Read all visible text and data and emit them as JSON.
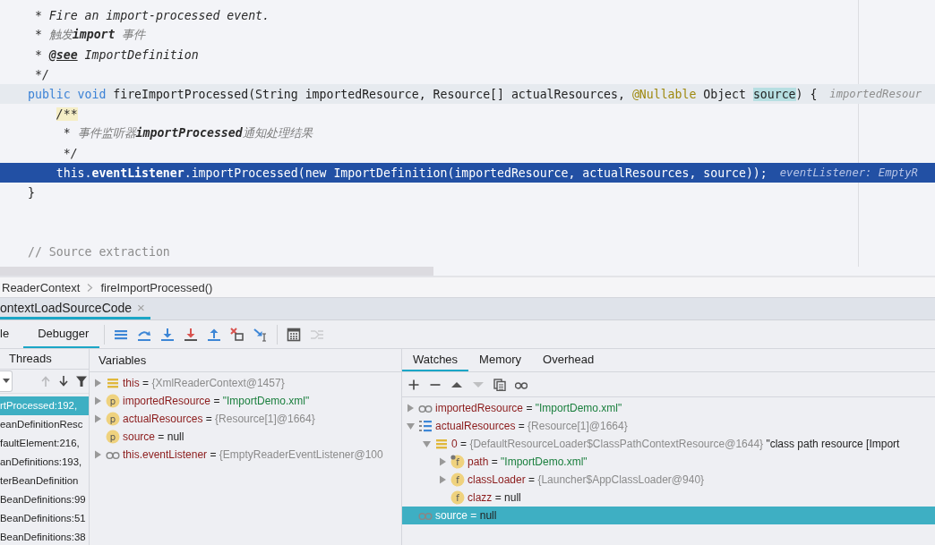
{
  "editor": {
    "lines": [
      {
        "current": false,
        "execution_point": false,
        "tokens": [
          {
            "kind": "doc",
            "text": " * Fire an import-processed event."
          }
        ]
      },
      {
        "current": false,
        "execution_point": false,
        "tokens": [
          {
            "kind": "doc",
            "text": " * "
          },
          {
            "kind": "doc-cjk",
            "text": "触发"
          },
          {
            "kind": "doc-bold",
            "text": "import"
          },
          {
            "kind": "doc-cjk",
            "text": " 事件"
          }
        ]
      },
      {
        "current": false,
        "execution_point": false,
        "tokens": [
          {
            "kind": "doc",
            "text": " * "
          },
          {
            "kind": "doc-tag",
            "text": "@see"
          },
          {
            "kind": "doc",
            "text": " ImportDefinition"
          }
        ]
      },
      {
        "current": false,
        "execution_point": false,
        "tokens": [
          {
            "kind": "doc",
            "text": " */"
          }
        ]
      },
      {
        "current": true,
        "execution_point": false,
        "hint": "importedResour",
        "tokens": [
          {
            "kind": "keyword",
            "text": "public void "
          },
          {
            "kind": "plain",
            "text": "fireImportProcessed(String importedResource, Resource[] actualResources, "
          },
          {
            "kind": "annotation",
            "text": "@Nullable"
          },
          {
            "kind": "plain",
            "text": " Object "
          },
          {
            "kind": "usage",
            "text": "source"
          },
          {
            "kind": "plain",
            "text": ") {"
          }
        ]
      },
      {
        "current": false,
        "execution_point": false,
        "tokens": [
          {
            "kind": "doc-start",
            "text": "    /**"
          }
        ]
      },
      {
        "current": false,
        "execution_point": false,
        "tokens": [
          {
            "kind": "doc",
            "text": "     * "
          },
          {
            "kind": "doc-cjk",
            "text": "事件监听器"
          },
          {
            "kind": "doc-bold",
            "text": "importProcessed"
          },
          {
            "kind": "doc-cjk",
            "text": "通知处理结果"
          }
        ]
      },
      {
        "current": false,
        "execution_point": false,
        "tokens": [
          {
            "kind": "doc",
            "text": "     */"
          }
        ]
      },
      {
        "current": false,
        "execution_point": true,
        "hint": "eventListener: EmptyR",
        "tokens": [
          {
            "kind": "plain",
            "text": "    this."
          },
          {
            "kind": "field",
            "text": "eventListener"
          },
          {
            "kind": "plain",
            "text": ".importProcessed(new ImportDefinition(importedResource, actualResources, source));"
          }
        ]
      },
      {
        "current": false,
        "execution_point": false,
        "tokens": [
          {
            "kind": "plain",
            "text": "}"
          }
        ]
      },
      {
        "current": false,
        "execution_point": false
      },
      {
        "current": false,
        "execution_point": false
      },
      {
        "current": false,
        "execution_point": false,
        "tokens": [
          {
            "kind": "comment",
            "text": "// Source extraction"
          }
        ]
      }
    ]
  },
  "breadcrumbs": [
    "ReaderContext",
    "fireImportProcessed()"
  ],
  "run_tabs": [
    {
      "label": "ontextLoadSourceCode",
      "close": "×",
      "selected": true
    }
  ],
  "debug_tabs": [
    {
      "label": "le",
      "selected": false
    },
    {
      "label": "Debugger",
      "selected": true
    }
  ],
  "debug_toolbar": [
    {
      "disabled": false
    },
    {
      "disabled": false
    },
    {
      "disabled": false
    },
    {
      "disabled": false
    },
    {
      "disabled": false
    },
    {
      "disabled": false
    },
    {
      "disabled": false
    },
    {
      "disabled": false
    },
    {
      "disabled": true
    }
  ],
  "threads": {
    "title": "Threads",
    "toolbar": [
      {
        "disabled": true
      },
      {
        "disabled": false
      },
      {
        "disabled": false
      }
    ],
    "frames": [
      {
        "label": "rtProcessed:192,",
        "selected": true
      },
      {
        "label": "eanDefinitionResc",
        "selected": false
      },
      {
        "label": "faultElement:216,",
        "selected": false
      },
      {
        "label": "anDefinitions:193,",
        "selected": false
      },
      {
        "label": "terBeanDefinition",
        "selected": false
      },
      {
        "label": "BeanDefinitions:99",
        "selected": false
      },
      {
        "label": "BeanDefinitions:51",
        "selected": false
      },
      {
        "label": "BeanDefinitions:38",
        "selected": false
      }
    ]
  },
  "variables": {
    "title": "Variables",
    "rows": [
      {
        "expanded": false,
        "kind": "object",
        "name": "this",
        "sep": "=",
        "value": {
          "kind": "object",
          "text": "{XmlReaderContext@1457}"
        },
        "selected": false
      },
      {
        "expanded": false,
        "kind": "param",
        "badge": "p",
        "name": "importedResource",
        "sep": "=",
        "value": {
          "kind": "string",
          "text": "\"ImportDemo.xml\""
        },
        "selected": false
      },
      {
        "expanded": false,
        "kind": "param",
        "badge": "p",
        "name": "actualResources",
        "sep": "=",
        "value": {
          "kind": "object",
          "text": "{Resource[1]@1664}"
        },
        "selected": false
      },
      {
        "kind": "param",
        "badge": "p",
        "name": "source",
        "sep": "=",
        "value": {
          "kind": "null",
          "text": "null"
        },
        "selected": false
      },
      {
        "expanded": false,
        "kind": "watch",
        "name": "this.eventListener",
        "sep": "=",
        "value": {
          "kind": "object",
          "text": "{EmptyReaderEventListener@100"
        },
        "selected": false
      }
    ]
  },
  "watches": {
    "tabs": [
      {
        "label": "Watches",
        "selected": true
      },
      {
        "label": "Memory",
        "selected": false
      },
      {
        "label": "Overhead",
        "selected": false
      }
    ],
    "toolbar": [
      {
        "disabled": false
      },
      {
        "disabled": false
      },
      {
        "disabled": false
      },
      {
        "disabled": true
      },
      {
        "disabled": false
      },
      {
        "disabled": false
      }
    ],
    "rows": [
      {
        "expanded": false,
        "kind": "watch",
        "name": "importedResource",
        "sep": "=",
        "value": {
          "kind": "string",
          "text": "\"ImportDemo.xml\""
        },
        "selected": false
      },
      {
        "expanded": true,
        "kind": "array",
        "name": "actualResources",
        "sep": "=",
        "value": {
          "kind": "object",
          "text": "{Resource[1]@1664}"
        },
        "selected": false,
        "children": [
          {
            "expanded": true,
            "kind": "object",
            "name": "0",
            "sep": "=",
            "value": {
              "kind": "object",
              "text": "{DefaultResourceLoader$ClassPathContextResource@1644}"
            },
            "description": "\"class path resource [Import",
            "selected": false,
            "children": [
              {
                "expanded": false,
                "kind": "field",
                "badge": "f",
                "final": true,
                "name": "path",
                "sep": "=",
                "value": {
                  "kind": "string",
                  "text": "\"ImportDemo.xml\""
                },
                "selected": false
              },
              {
                "expanded": false,
                "kind": "field",
                "badge": "f",
                "final": false,
                "name": "classLoader",
                "sep": "=",
                "value": {
                  "kind": "object",
                  "text": "{Launcher$AppClassLoader@940}"
                },
                "selected": false
              },
              {
                "kind": "field",
                "badge": "f",
                "final": false,
                "name": "clazz",
                "sep": "=",
                "value": {
                  "kind": "null",
                  "text": "null"
                },
                "selected": false
              }
            ]
          }
        ]
      },
      {
        "kind": "watch",
        "name": "source",
        "sep": "=",
        "value": {
          "kind": "null",
          "text": "null"
        },
        "selected": true
      }
    ]
  }
}
